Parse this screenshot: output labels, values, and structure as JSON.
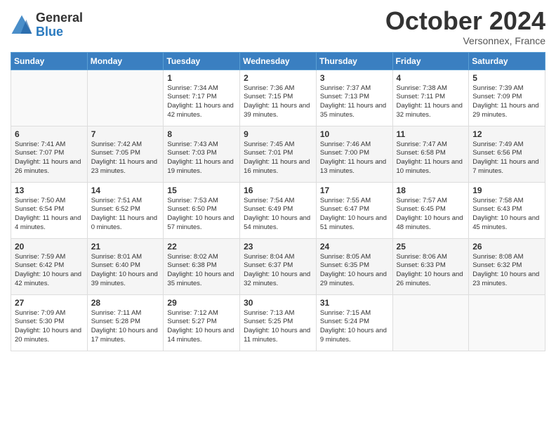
{
  "header": {
    "logo_general": "General",
    "logo_blue": "Blue",
    "month_title": "October 2024",
    "subtitle": "Versonnex, France"
  },
  "days_of_week": [
    "Sunday",
    "Monday",
    "Tuesday",
    "Wednesday",
    "Thursday",
    "Friday",
    "Saturday"
  ],
  "weeks": [
    [
      {
        "day": "",
        "info": ""
      },
      {
        "day": "",
        "info": ""
      },
      {
        "day": "1",
        "info": "Sunrise: 7:34 AM\nSunset: 7:17 PM\nDaylight: 11 hours and 42 minutes."
      },
      {
        "day": "2",
        "info": "Sunrise: 7:36 AM\nSunset: 7:15 PM\nDaylight: 11 hours and 39 minutes."
      },
      {
        "day": "3",
        "info": "Sunrise: 7:37 AM\nSunset: 7:13 PM\nDaylight: 11 hours and 35 minutes."
      },
      {
        "day": "4",
        "info": "Sunrise: 7:38 AM\nSunset: 7:11 PM\nDaylight: 11 hours and 32 minutes."
      },
      {
        "day": "5",
        "info": "Sunrise: 7:39 AM\nSunset: 7:09 PM\nDaylight: 11 hours and 29 minutes."
      }
    ],
    [
      {
        "day": "6",
        "info": "Sunrise: 7:41 AM\nSunset: 7:07 PM\nDaylight: 11 hours and 26 minutes."
      },
      {
        "day": "7",
        "info": "Sunrise: 7:42 AM\nSunset: 7:05 PM\nDaylight: 11 hours and 23 minutes."
      },
      {
        "day": "8",
        "info": "Sunrise: 7:43 AM\nSunset: 7:03 PM\nDaylight: 11 hours and 19 minutes."
      },
      {
        "day": "9",
        "info": "Sunrise: 7:45 AM\nSunset: 7:01 PM\nDaylight: 11 hours and 16 minutes."
      },
      {
        "day": "10",
        "info": "Sunrise: 7:46 AM\nSunset: 7:00 PM\nDaylight: 11 hours and 13 minutes."
      },
      {
        "day": "11",
        "info": "Sunrise: 7:47 AM\nSunset: 6:58 PM\nDaylight: 11 hours and 10 minutes."
      },
      {
        "day": "12",
        "info": "Sunrise: 7:49 AM\nSunset: 6:56 PM\nDaylight: 11 hours and 7 minutes."
      }
    ],
    [
      {
        "day": "13",
        "info": "Sunrise: 7:50 AM\nSunset: 6:54 PM\nDaylight: 11 hours and 4 minutes."
      },
      {
        "day": "14",
        "info": "Sunrise: 7:51 AM\nSunset: 6:52 PM\nDaylight: 11 hours and 0 minutes."
      },
      {
        "day": "15",
        "info": "Sunrise: 7:53 AM\nSunset: 6:50 PM\nDaylight: 10 hours and 57 minutes."
      },
      {
        "day": "16",
        "info": "Sunrise: 7:54 AM\nSunset: 6:49 PM\nDaylight: 10 hours and 54 minutes."
      },
      {
        "day": "17",
        "info": "Sunrise: 7:55 AM\nSunset: 6:47 PM\nDaylight: 10 hours and 51 minutes."
      },
      {
        "day": "18",
        "info": "Sunrise: 7:57 AM\nSunset: 6:45 PM\nDaylight: 10 hours and 48 minutes."
      },
      {
        "day": "19",
        "info": "Sunrise: 7:58 AM\nSunset: 6:43 PM\nDaylight: 10 hours and 45 minutes."
      }
    ],
    [
      {
        "day": "20",
        "info": "Sunrise: 7:59 AM\nSunset: 6:42 PM\nDaylight: 10 hours and 42 minutes."
      },
      {
        "day": "21",
        "info": "Sunrise: 8:01 AM\nSunset: 6:40 PM\nDaylight: 10 hours and 39 minutes."
      },
      {
        "day": "22",
        "info": "Sunrise: 8:02 AM\nSunset: 6:38 PM\nDaylight: 10 hours and 35 minutes."
      },
      {
        "day": "23",
        "info": "Sunrise: 8:04 AM\nSunset: 6:37 PM\nDaylight: 10 hours and 32 minutes."
      },
      {
        "day": "24",
        "info": "Sunrise: 8:05 AM\nSunset: 6:35 PM\nDaylight: 10 hours and 29 minutes."
      },
      {
        "day": "25",
        "info": "Sunrise: 8:06 AM\nSunset: 6:33 PM\nDaylight: 10 hours and 26 minutes."
      },
      {
        "day": "26",
        "info": "Sunrise: 8:08 AM\nSunset: 6:32 PM\nDaylight: 10 hours and 23 minutes."
      }
    ],
    [
      {
        "day": "27",
        "info": "Sunrise: 7:09 AM\nSunset: 5:30 PM\nDaylight: 10 hours and 20 minutes."
      },
      {
        "day": "28",
        "info": "Sunrise: 7:11 AM\nSunset: 5:28 PM\nDaylight: 10 hours and 17 minutes."
      },
      {
        "day": "29",
        "info": "Sunrise: 7:12 AM\nSunset: 5:27 PM\nDaylight: 10 hours and 14 minutes."
      },
      {
        "day": "30",
        "info": "Sunrise: 7:13 AM\nSunset: 5:25 PM\nDaylight: 10 hours and 11 minutes."
      },
      {
        "day": "31",
        "info": "Sunrise: 7:15 AM\nSunset: 5:24 PM\nDaylight: 10 hours and 9 minutes."
      },
      {
        "day": "",
        "info": ""
      },
      {
        "day": "",
        "info": ""
      }
    ]
  ]
}
